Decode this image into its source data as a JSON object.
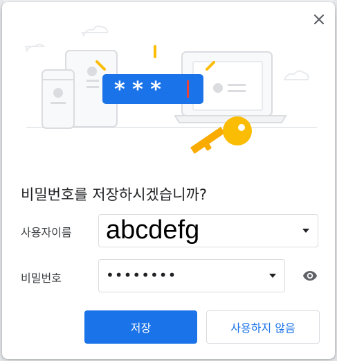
{
  "dialog": {
    "title": "비밀번호를 저장하시겠습니까?",
    "close_icon": "close-icon",
    "illustration": {
      "masked_password": "* * *",
      "icons": [
        "phone-icon",
        "tablet-icon",
        "laptop-icon",
        "key-icon",
        "cloud-icon"
      ]
    },
    "username": {
      "label": "사용자이름",
      "value": "abcdefg"
    },
    "password": {
      "label": "비밀번호",
      "value": "••••••••",
      "reveal_icon": "eye-icon"
    },
    "buttons": {
      "save": "저장",
      "never": "사용하지 않음"
    }
  },
  "colors": {
    "accent": "#1a73e8",
    "key": "#f9ab00",
    "caret": "#ea4335",
    "illustration_gray": "#dadce0"
  }
}
